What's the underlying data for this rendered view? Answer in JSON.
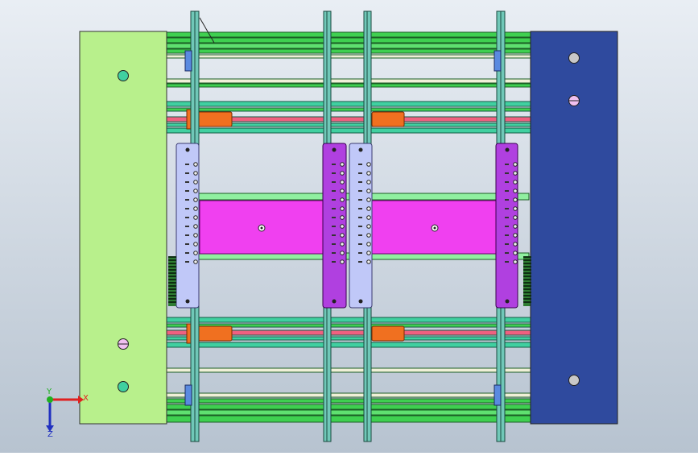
{
  "viewport": {
    "background_top": "#e9eef4",
    "background_bottom": "#b7c3d0"
  },
  "triad": {
    "x_label": "X",
    "y_label": "Y",
    "z_label": "Z",
    "x_color": "#e02020",
    "y_color": "#20b020",
    "z_color": "#2030c0"
  },
  "colors": {
    "left_plate": "#b8f08c",
    "right_plate": "#2f4a9e",
    "rail_green": "#3fd050",
    "rod_teal": "#40d0a0",
    "rod_pink": "#f06080",
    "slider_orange": "#f07020",
    "center_block": "#f040f0",
    "lavender_plate": "#c0c8f8",
    "purple_plate": "#b040e0",
    "rib": "#70c8b8"
  }
}
